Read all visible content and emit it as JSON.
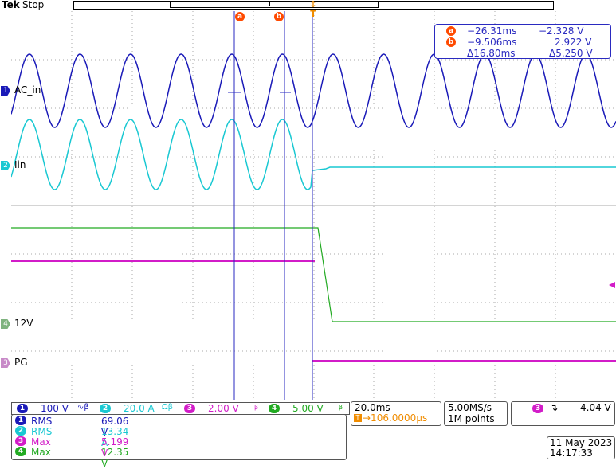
{
  "header": {
    "brand": "Tek",
    "status": "Stop"
  },
  "colors": {
    "ch1": "#1a1ab8",
    "ch2": "#19c8d2",
    "ch3": "#d21cc8",
    "ch4": "#22aa22",
    "cursor": "#2a2ac0",
    "trigger": "#f08c00",
    "badge": "#ff4a00",
    "grid": "#a8a8a8"
  },
  "markers": {
    "a": "a",
    "b": "b",
    "trigger": "T"
  },
  "cursor_readout": {
    "a_time": "−26.31ms",
    "a_value": "−2.328 V",
    "b_time": "−9.506ms",
    "b_value": "2.922 V",
    "delta_time": "Δ16.80ms",
    "delta_value": "Δ5.250 V"
  },
  "channels": [
    {
      "num": "1",
      "label": "AC_in",
      "scale": "100 V"
    },
    {
      "num": "2",
      "label": "Iin",
      "scale": "20.0 A"
    },
    {
      "num": "3",
      "label": "PG",
      "scale": "2.00 V"
    },
    {
      "num": "4",
      "label": "12V",
      "scale": "5.00 V"
    }
  ],
  "timebase": {
    "scale": "20.0ms",
    "trigger_pos": "→106.0000µs",
    "sample_rate": "5.00MS/s",
    "record_length": "1M points",
    "trigger_channel": "3",
    "trigger_level": "4.04 V"
  },
  "measurements": [
    {
      "ch": "1",
      "type": "RMS",
      "value": "69.06 V"
    },
    {
      "ch": "2",
      "type": "RMS",
      "value": "13.34 A"
    },
    {
      "ch": "3",
      "type": "Max",
      "value": "5.199 V"
    },
    {
      "ch": "4",
      "type": "Max",
      "value": "12.35 V"
    }
  ],
  "datetime": {
    "date": "11 May 2023",
    "time": "14:17:33"
  }
}
